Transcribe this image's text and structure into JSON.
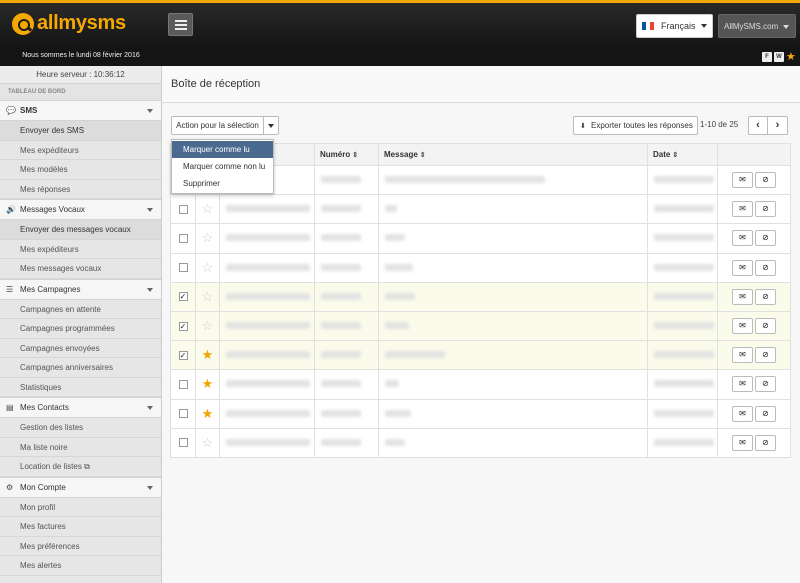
{
  "app": {
    "logo_text": "allmysms"
  },
  "header": {
    "language": "Français",
    "account": "AllMySMS.com",
    "date_text": "Nous sommes le lundi 08 février 2016",
    "icon_f": "F",
    "icon_w": "W"
  },
  "sidebar": {
    "server_time": "Heure serveur : 10:36:12",
    "dashboard_label": "TABLEAU DE BORD",
    "sections": [
      {
        "label": "SMS",
        "icon": "chat-icon",
        "items": [
          "Envoyer des SMS",
          "Mes expéditeurs",
          "Mes modèles",
          "Mes réponses"
        ]
      },
      {
        "label": "Messages Vocaux",
        "icon": "speaker-icon",
        "items": [
          "Envoyer des messages vocaux",
          "Mes expéditeurs",
          "Mes messages vocaux"
        ]
      },
      {
        "label": "Mes Campagnes",
        "icon": "list-icon",
        "items": [
          "Campagnes en attente",
          "Campagnes programmées",
          "Campagnes envoyées",
          "Campagnes anniversaires",
          "Statistiques"
        ]
      },
      {
        "label": "Mes Contacts",
        "icon": "contacts-icon",
        "items": [
          "Gestion des listes",
          "Ma liste noire",
          "Location de listes"
        ]
      },
      {
        "label": "Mon Compte",
        "icon": "gear-icon",
        "items": [
          "Mon profil",
          "Mes factures",
          "Mes préférences",
          "Mes alertes"
        ]
      }
    ]
  },
  "main": {
    "title": "Boîte de réception",
    "action_label": "Action pour la sélection",
    "export_label": "Exporter toutes les réponses",
    "pagination": "1-10 de 25",
    "prev": "‹",
    "next": "›",
    "columns": {
      "number": "Numéro",
      "message": "Message",
      "date": "Date"
    },
    "dropdown": [
      "Marquer comme lu",
      "Marquer comme non lu",
      "Supprimer"
    ],
    "rows": [
      {
        "checked": false,
        "starred": false,
        "selected": false
      },
      {
        "checked": false,
        "starred": false,
        "selected": false
      },
      {
        "checked": false,
        "starred": false,
        "selected": false
      },
      {
        "checked": false,
        "starred": false,
        "selected": false
      },
      {
        "checked": true,
        "starred": false,
        "selected": true
      },
      {
        "checked": true,
        "starred": false,
        "selected": true
      },
      {
        "checked": true,
        "starred": true,
        "selected": true
      },
      {
        "checked": false,
        "starred": true,
        "selected": false
      },
      {
        "checked": false,
        "starred": true,
        "selected": false
      },
      {
        "checked": false,
        "starred": false,
        "selected": false
      }
    ]
  },
  "colors": {
    "brand": "#f5a800",
    "highlight": "#4a6b8f",
    "selected_row": "#fbfbeb"
  }
}
